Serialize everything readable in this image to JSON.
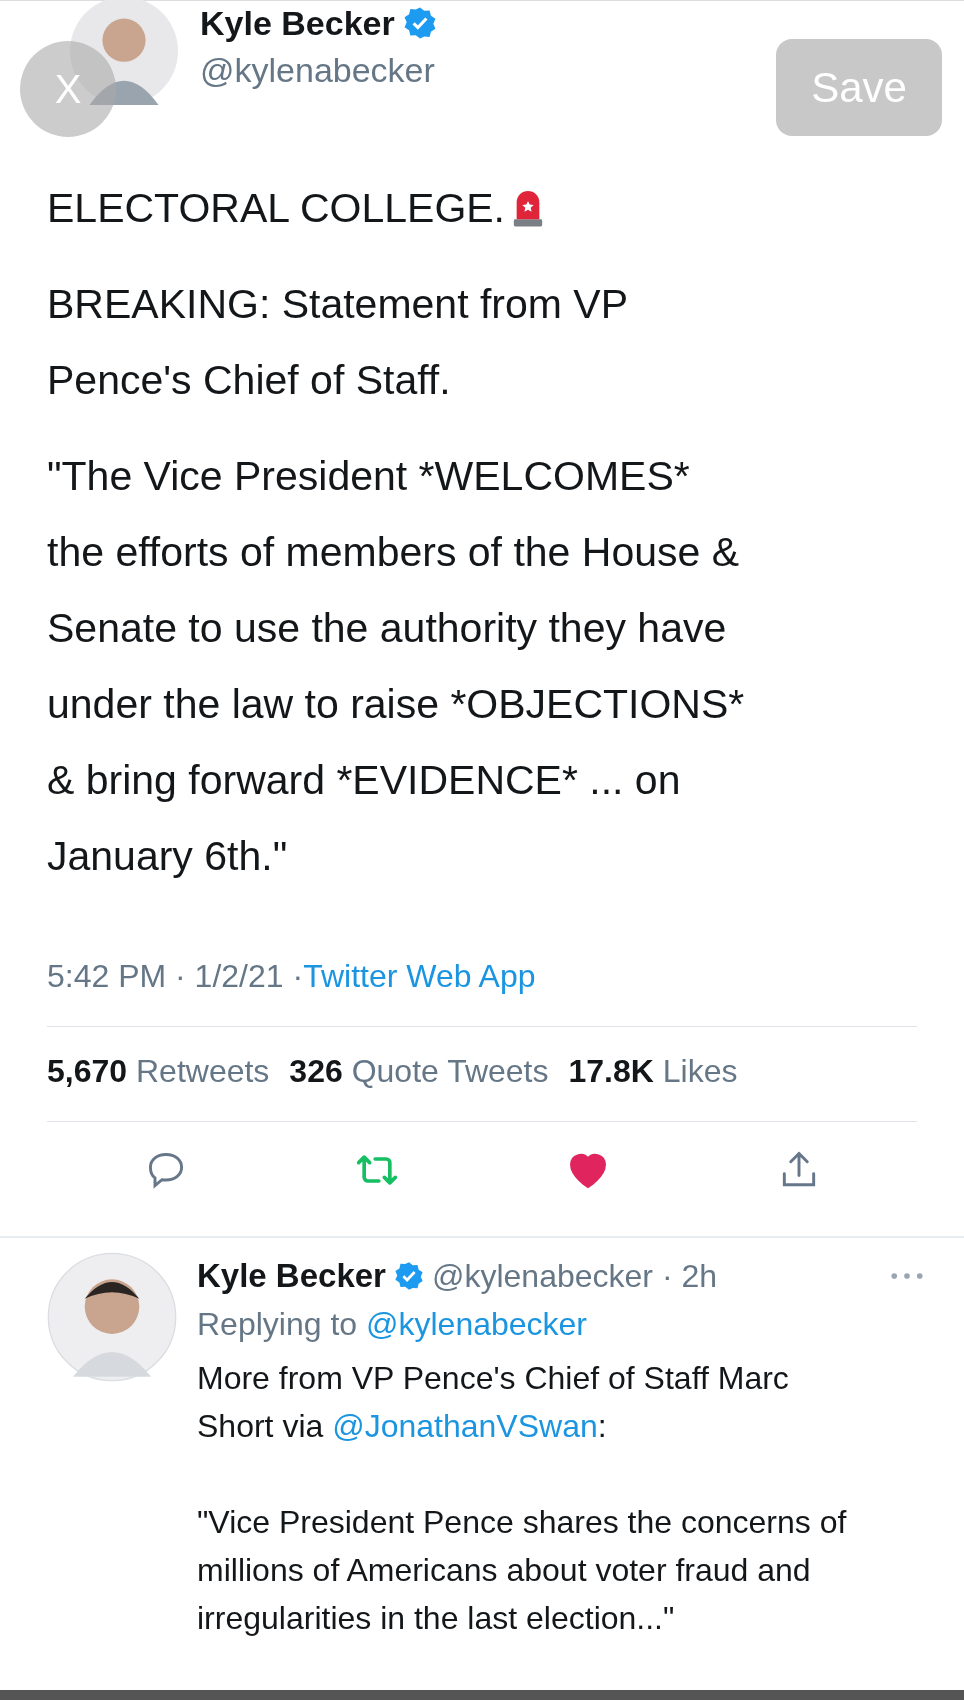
{
  "overlay": {
    "close_label": "X",
    "save_label": "Save"
  },
  "tweet": {
    "author": {
      "name": "Kyle Becker",
      "verified": true,
      "handle": "@kylenabecker"
    },
    "paragraphs": [
      {
        "lines": [
          "ELECTORAL COLLEGE."
        ],
        "siren": true
      },
      {
        "lines": [
          "BREAKING: Statement from VP",
          "Pence's Chief of Staff."
        ],
        "siren": false
      },
      {
        "lines": [
          "\"The Vice President *WELCOMES*",
          "the efforts of members of the House &",
          "Senate to use the authority they have",
          "under the law to raise *OBJECTIONS*",
          "& bring forward *EVIDENCE*  ... on",
          "January 6th.\""
        ],
        "siren": false
      }
    ],
    "time": "5:42 PM",
    "date": "1/2/21",
    "separators": [
      "·",
      "·"
    ],
    "source": "Twitter Web App",
    "stats": [
      {
        "count": "5,670",
        "label": "Retweets"
      },
      {
        "count": "326",
        "label": "Quote Tweets"
      },
      {
        "count": "17.8K",
        "label": "Likes"
      }
    ],
    "actions": {
      "retweeted": true,
      "liked": true
    }
  },
  "reply": {
    "author": {
      "name": "Kyle Becker",
      "verified": true,
      "handle": "@kylenabecker",
      "separator": "·",
      "age": "2h"
    },
    "replying_prefix": "Replying to",
    "replying_to": "@kylenabecker",
    "paragraphs": [
      {
        "before": "More from VP Pence's Chief of Staff Marc Short via ",
        "mention": "@JonathanVSwan",
        "after": ":"
      },
      {
        "before": "\"Vice President Pence shares the concerns of millions of Americans about voter fraud and irregularities in the last election...\""
      }
    ]
  }
}
